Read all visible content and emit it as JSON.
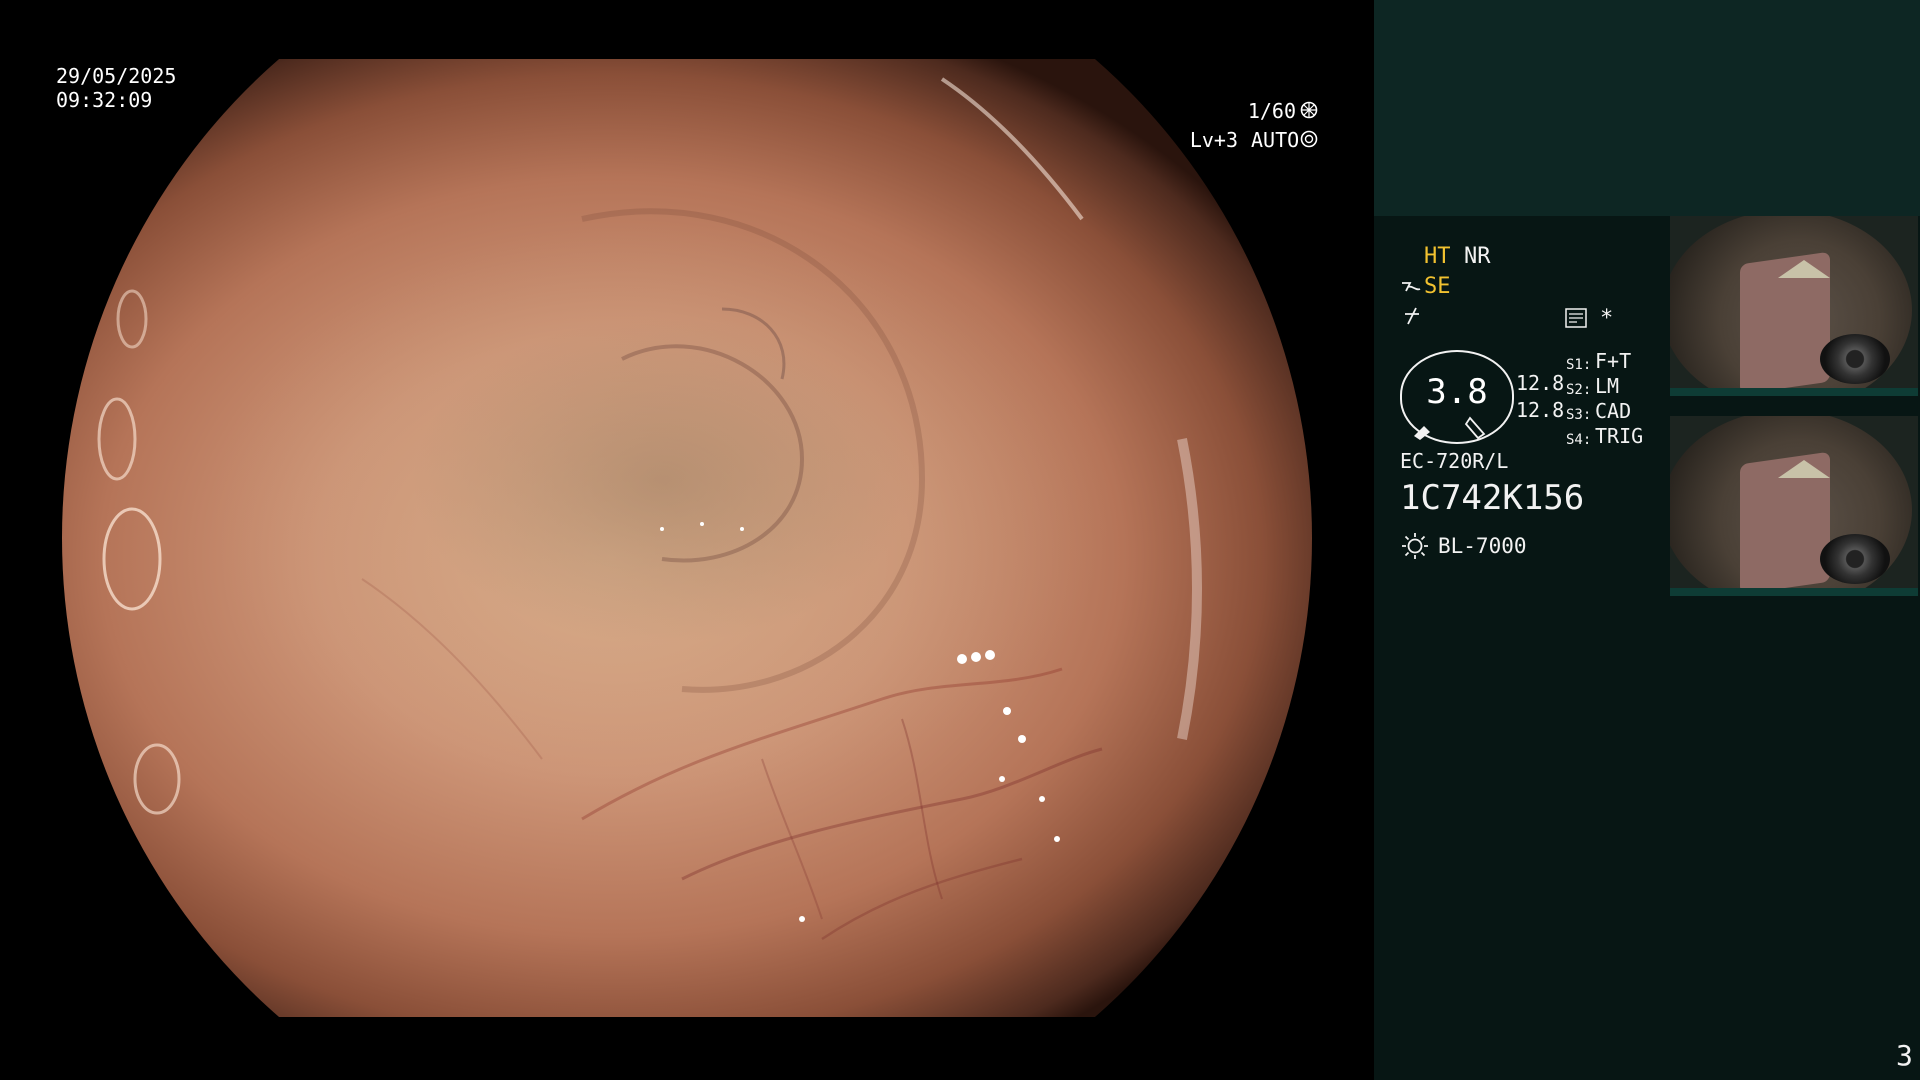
{
  "osd": {
    "date": "29/05/2025",
    "time": "09:32:09",
    "shutter": "1/60",
    "level": "Lv+3",
    "mode": "AUTO"
  },
  "panel": {
    "ht": "HT",
    "nr": "NR",
    "se": "SE",
    "star": "*",
    "gauge_value": "3.8",
    "side_value_1": "12.8",
    "side_value_2": "12.8",
    "s1_label": "S1:",
    "s1_value": "F+T",
    "s2_label": "S2:",
    "s2_value": "LM",
    "s3_label": "S3:",
    "s3_value": "CAD",
    "s4_label": "S4:",
    "s4_value": "TRIG",
    "scope_model": "EC-720R/L",
    "serial": "1C742K156",
    "light_source": "BL-7000",
    "page_number": "3"
  },
  "colors": {
    "accent_yellow": "#f2c230",
    "panel_bg": "#071614",
    "panel_top_bg": "#0d2623"
  }
}
